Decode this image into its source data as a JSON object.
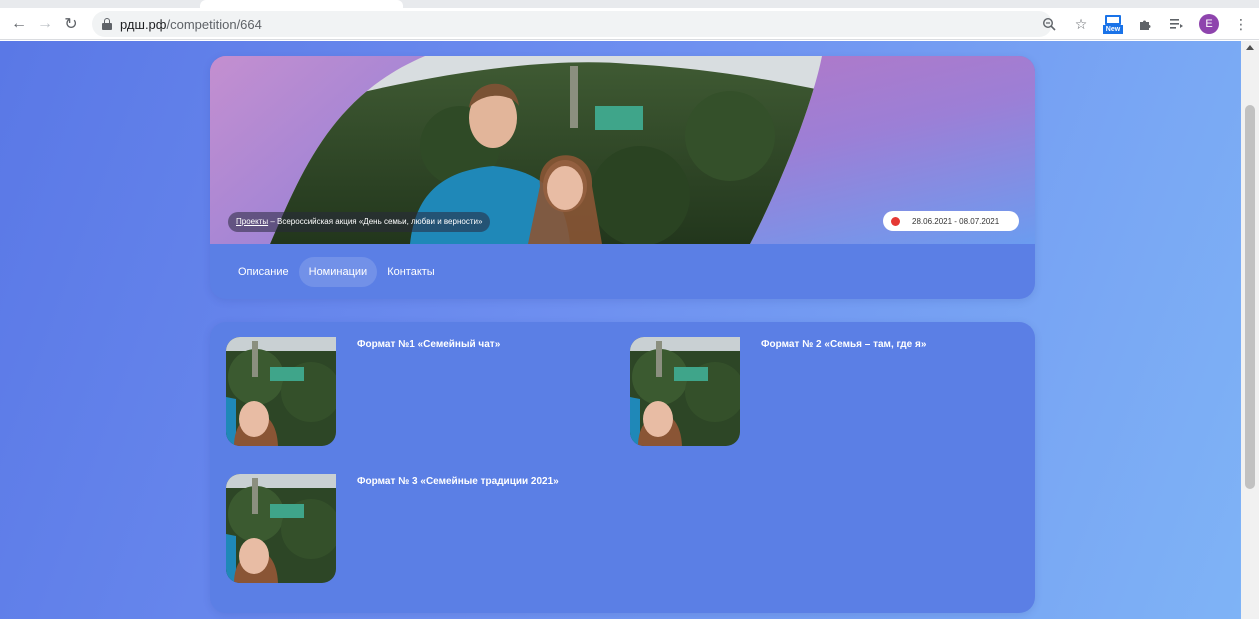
{
  "browser": {
    "url_host": "рдш.рф",
    "url_path": "/competition/664",
    "avatar_letter": "E",
    "ext_label": "New",
    "icons": [
      "back-arrow-icon",
      "forward-arrow-icon",
      "reload-icon",
      "lock-icon",
      "zoom-icon",
      "star-icon",
      "extension-new-icon",
      "puzzle-icon",
      "reading-list-icon",
      "avatar",
      "menu-dots-icon"
    ]
  },
  "header": {
    "breadcrumb_link": "Проекты",
    "breadcrumb_rest": " – Всероссийская акция «День семьи, любви и верности»",
    "dates": "28.06.2021 - 08.07.2021",
    "status_color": "#e53935"
  },
  "tabs": [
    {
      "label": "Описание",
      "active": false
    },
    {
      "label": "Номинации",
      "active": true
    },
    {
      "label": "Контакты",
      "active": false
    }
  ],
  "nominations": [
    {
      "title": "Формат №1 «Семейный чат»"
    },
    {
      "title": "Формат № 2 «Семья – там, где я»"
    },
    {
      "title": "Формат № 3 «Семейные традиции 2021»"
    }
  ],
  "colors": {
    "card": "#5b7fe5",
    "background_start": "#5a78e6",
    "background_end": "#7fb4f6"
  }
}
